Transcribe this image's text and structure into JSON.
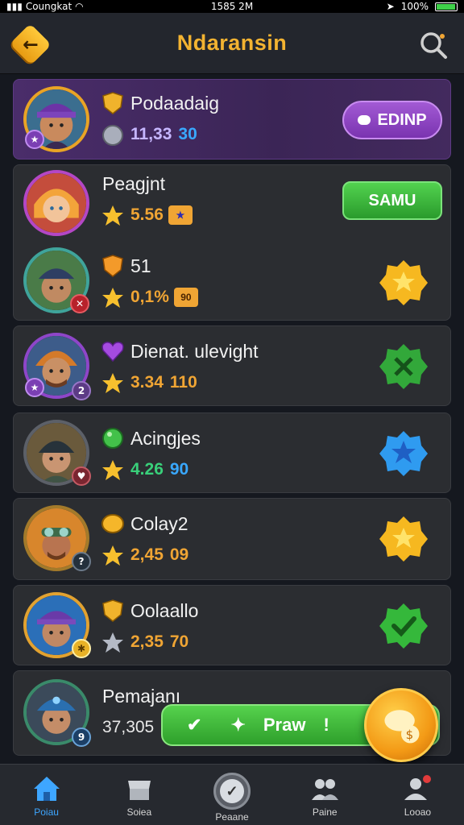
{
  "status_bar": {
    "carrier": "Coungkat",
    "time": "1585 2M",
    "battery": "100%"
  },
  "header": {
    "title": "Ndaransin"
  },
  "players": [
    {
      "name": "Podaadaig",
      "stat_main": "11,33",
      "stat_alt": "30",
      "action": "EDINP",
      "rank_icon": "gold-shield-icon",
      "stat_icon": "silver-coin-icon"
    },
    {
      "name": "Peagjnt",
      "stat_main": "5.56",
      "action": "SAMU",
      "rank_icon": "",
      "stat_icon": "star-icon"
    },
    {
      "name": "51",
      "stat_main": "0,1%",
      "chip": "90",
      "badge": "gold-star-badge-icon",
      "rank_icon": "orange-shield-icon",
      "stat_icon": "star-icon"
    },
    {
      "name": "Dienat. ulevight",
      "stat_main": "3.34",
      "stat_alt": "110",
      "badge": "green-badge-icon",
      "rank_icon": "purple-heart-icon",
      "stat_icon": "star-icon"
    },
    {
      "name": "Acingjes",
      "stat_main": "4.26",
      "stat_alt": "90",
      "badge": "blue-star-badge-icon",
      "rank_icon": "green-gem-icon",
      "stat_icon": "star-icon"
    },
    {
      "name": "Colay2",
      "stat_main": "2,45",
      "stat_alt": "09",
      "badge": "gold-star-badge-icon",
      "rank_icon": "gold-coin-icon",
      "stat_icon": "star-icon"
    },
    {
      "name": "Oolaallo",
      "stat_main": "2,35",
      "stat_alt": "70",
      "badge": "green-check-badge-icon",
      "rank_icon": "gold-shield-icon",
      "stat_icon": "silver-star-icon"
    },
    {
      "name": "Pemajanı",
      "stat_main": "37,305",
      "rank_icon": "",
      "stat_icon": ""
    }
  ],
  "float_bar": {
    "label": "Praw",
    "bang": "!"
  },
  "bottom_nav": [
    {
      "label": "Poiau",
      "icon": "home-icon",
      "active": true
    },
    {
      "label": "Soiea",
      "icon": "shop-icon",
      "active": false
    },
    {
      "label": "Peaane",
      "icon": "check-circle-icon",
      "active": false
    },
    {
      "label": "Paine",
      "icon": "friends-icon",
      "active": false
    },
    {
      "label": "Looao",
      "icon": "profile-icon",
      "active": false
    }
  ],
  "colors": {
    "accent_gold": "#f3b331",
    "highlight_purple": "#4a2d6a",
    "green": "#3fb63b",
    "blue_active": "#3ea6ff"
  }
}
